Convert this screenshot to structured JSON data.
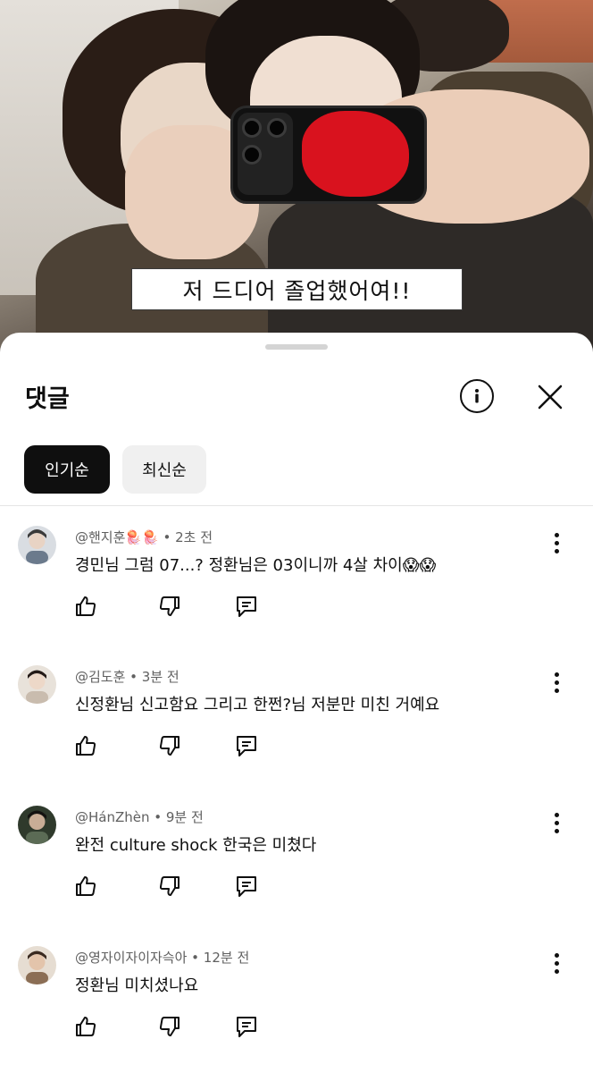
{
  "video": {
    "subtitle": "저 드디어 졸업했어여!!"
  },
  "comments_panel": {
    "title": "댓글",
    "sort_chips": [
      {
        "label": "인기순",
        "selected": true
      },
      {
        "label": "최신순",
        "selected": false
      }
    ],
    "comments": [
      {
        "meta": "@핸지훈🪼🪼 • 2초 전",
        "text": "경민님 그럼 07...? 정환님은 03이니까 4살 차이😱😱",
        "avatar_color": "#8a8f96"
      },
      {
        "meta": "@김도훈 • 3분 전",
        "text": "신정환님 신고함요 그리고 한쩐?님 저분만 미친 거예요",
        "avatar_color": "#b9aa98"
      },
      {
        "meta": "@HánZhèn • 9분 전",
        "text": "완전 culture shock 한국은 미쳤다",
        "avatar_color": "#4f5a4a"
      },
      {
        "meta": "@영자이자이자슥아 • 12분 전",
        "text": "정환님 미치셨나요",
        "avatar_color": "#8b6e55"
      }
    ]
  },
  "colors": {
    "text_primary": "#0f0f0f",
    "text_secondary": "#606060",
    "chip_active_bg": "#0f0f0f",
    "chip_idle_bg": "#f0f0f0"
  }
}
